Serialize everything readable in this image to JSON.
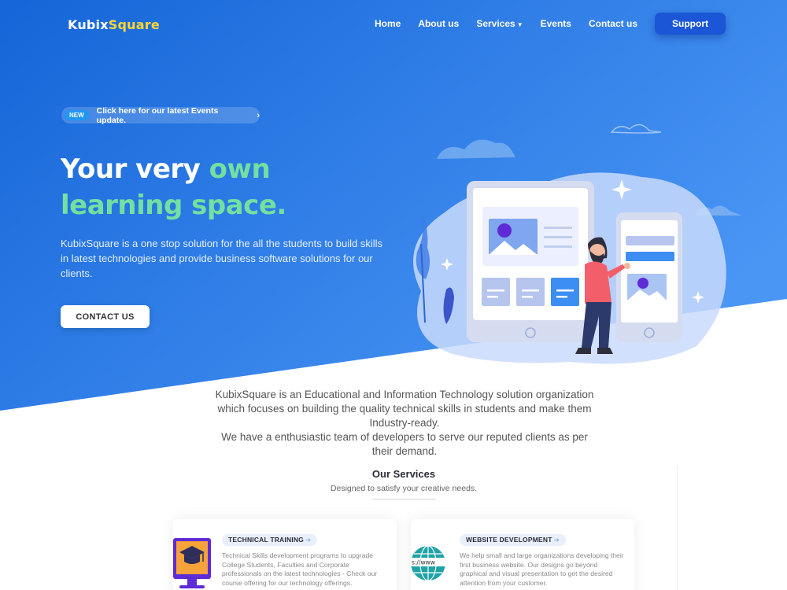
{
  "brand": {
    "part1": "Kubix",
    "part2": "Square"
  },
  "nav": {
    "home": "Home",
    "about": "About us",
    "services": "Services",
    "events": "Events",
    "contact": "Contact us",
    "support": "Support"
  },
  "announcement": {
    "badge": "NEW",
    "text": "Click here for our latest Events update."
  },
  "hero": {
    "headline_white": "Your very ",
    "headline_green_1": "own",
    "headline_green_2": "learning space.",
    "description": "KubixSquare is a one stop solution for the all the students to build skills in latest technologies and provide business software solutions for our clients.",
    "cta": "CONTACT US"
  },
  "about": {
    "text_1": "KubixSquare is an Educational and Information Technology solution organization which focuses on building the quality technical skills in students and make them Industry-ready.",
    "text_2": "We have a enthusiastic team of developers to serve our reputed clients as per their demand."
  },
  "services": {
    "title": "Our Services",
    "subtitle": "Designed to satisfy your creative needs.",
    "cards": [
      {
        "tag": "TECHNICAL TRAINING",
        "text": "Technical Skills development programs to upgrade College Students, Faculties and Corporate professionals on the latest technologies - Check our course offering for our technology offerings."
      },
      {
        "tag": "WEBSITE DEVELOPMENT",
        "text": "We help small and large organizations developing their first business website. Our designs go beyond graphical and visual presentation to get the desired attention from your customer.",
        "icon_label": "s://www"
      }
    ]
  },
  "colors": {
    "hero_gradient_start": "#1565d8",
    "hero_gradient_end": "#3d8bf2",
    "accent_green": "#72e0a0",
    "logo_yellow": "#ffd633",
    "support_button": "#1a56d6"
  }
}
